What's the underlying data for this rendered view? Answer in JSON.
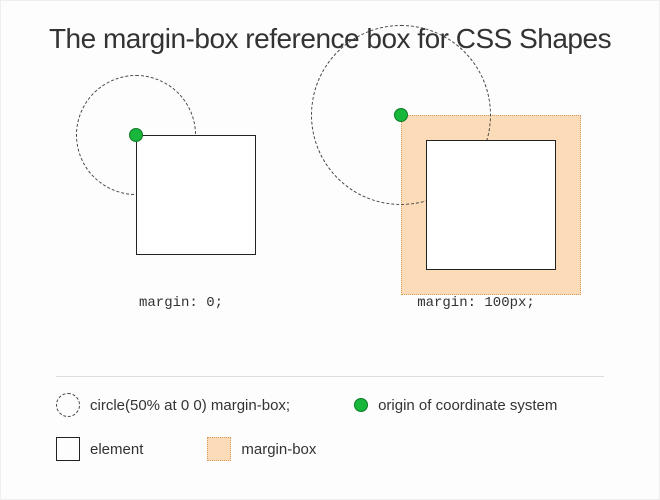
{
  "title": "The margin-box reference box for CSS Shapes",
  "panels": {
    "left": {
      "caption": "margin: 0;"
    },
    "right": {
      "caption": "margin: 100px;"
    }
  },
  "legend": {
    "shape_decl": "circle(50% at 0 0) margin-box;",
    "origin_label": "origin of coordinate system",
    "element_label": "element",
    "marginbox_label": "margin-box"
  }
}
